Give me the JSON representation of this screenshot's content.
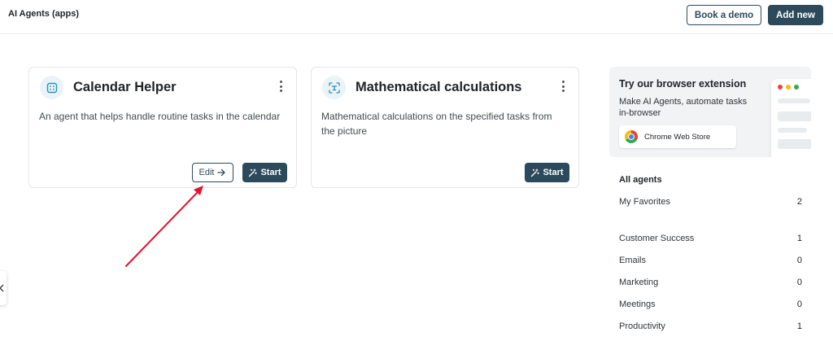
{
  "header": {
    "title": "AI Agents (apps)",
    "book_demo_label": "Book a demo",
    "add_new_label": "Add new"
  },
  "cards": [
    {
      "icon": "calendar-icon",
      "title": "Calendar Helper",
      "description": "An agent that helps handle routine tasks in the calendar",
      "edit_label": "Edit",
      "start_label": "Start"
    },
    {
      "icon": "scan-text-icon",
      "title": "Mathematical calculations",
      "description": "Mathematical calculations on the specified tasks from the picture",
      "start_label": "Start"
    }
  ],
  "promo": {
    "title": "Try our browser extension",
    "text": "Make AI Agents, automate tasks in-browser",
    "store_label": "Chrome Web Store"
  },
  "agents": {
    "heading": "All agents",
    "favorites": {
      "label": "My Favorites",
      "count": "2"
    },
    "categories": [
      {
        "label": "Customer Success",
        "count": "1"
      },
      {
        "label": "Emails",
        "count": "0"
      },
      {
        "label": "Marketing",
        "count": "0"
      },
      {
        "label": "Meetings",
        "count": "0"
      },
      {
        "label": "Productivity",
        "count": "1"
      }
    ]
  },
  "colors": {
    "primary": "#2c4a5b",
    "annotation_arrow": "#e0142d",
    "icon_bg": "#eaf4f8",
    "icon_fg": "#2a8fb8"
  }
}
